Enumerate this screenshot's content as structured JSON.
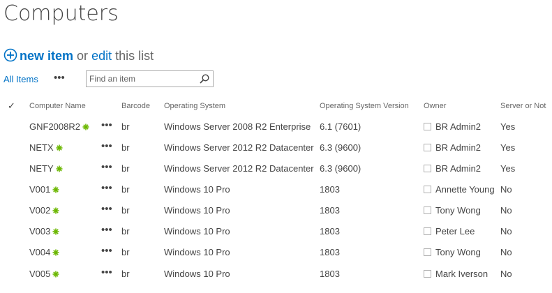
{
  "page": {
    "title": "Computers"
  },
  "actions": {
    "new_item": "new item",
    "or": "or",
    "edit": "edit",
    "this_list": "this list"
  },
  "view": {
    "current": "All Items",
    "more": "•••"
  },
  "search": {
    "placeholder": "Find an item"
  },
  "columns": [
    "Computer Name",
    "Barcode",
    "Operating System",
    "Operating System Version",
    "Owner",
    "Server or Not"
  ],
  "rows": [
    {
      "name": "GNF2008R2",
      "barcode": "br",
      "os": "Windows Server 2008 R2 Enterprise",
      "version": "6.1 (7601)",
      "owner": "BR Admin2",
      "server": "Yes"
    },
    {
      "name": "NETX",
      "barcode": "br",
      "os": "Windows Server 2012 R2 Datacenter",
      "version": "6.3 (9600)",
      "owner": "BR Admin2",
      "server": "Yes"
    },
    {
      "name": "NETY",
      "barcode": "br",
      "os": "Windows Server 2012 R2 Datacenter",
      "version": "6.3 (9600)",
      "owner": "BR Admin2",
      "server": "Yes"
    },
    {
      "name": "V001",
      "barcode": "br",
      "os": "Windows 10 Pro",
      "version": "1803",
      "owner": "Annette Young",
      "server": "No"
    },
    {
      "name": "V002",
      "barcode": "br",
      "os": "Windows 10 Pro",
      "version": "1803",
      "owner": "Tony Wong",
      "server": "No"
    },
    {
      "name": "V003",
      "barcode": "br",
      "os": "Windows 10 Pro",
      "version": "1803",
      "owner": "Peter Lee",
      "server": "No"
    },
    {
      "name": "V004",
      "barcode": "br",
      "os": "Windows 10 Pro",
      "version": "1803",
      "owner": "Tony Wong",
      "server": "No"
    },
    {
      "name": "V005",
      "barcode": "br",
      "os": "Windows 10 Pro",
      "version": "1803",
      "owner": "Mark Iverson",
      "server": "No"
    }
  ],
  "row_more": "•••",
  "colors": {
    "link": "#0072c6",
    "text": "#444444",
    "new_badge": "#6bb700"
  }
}
